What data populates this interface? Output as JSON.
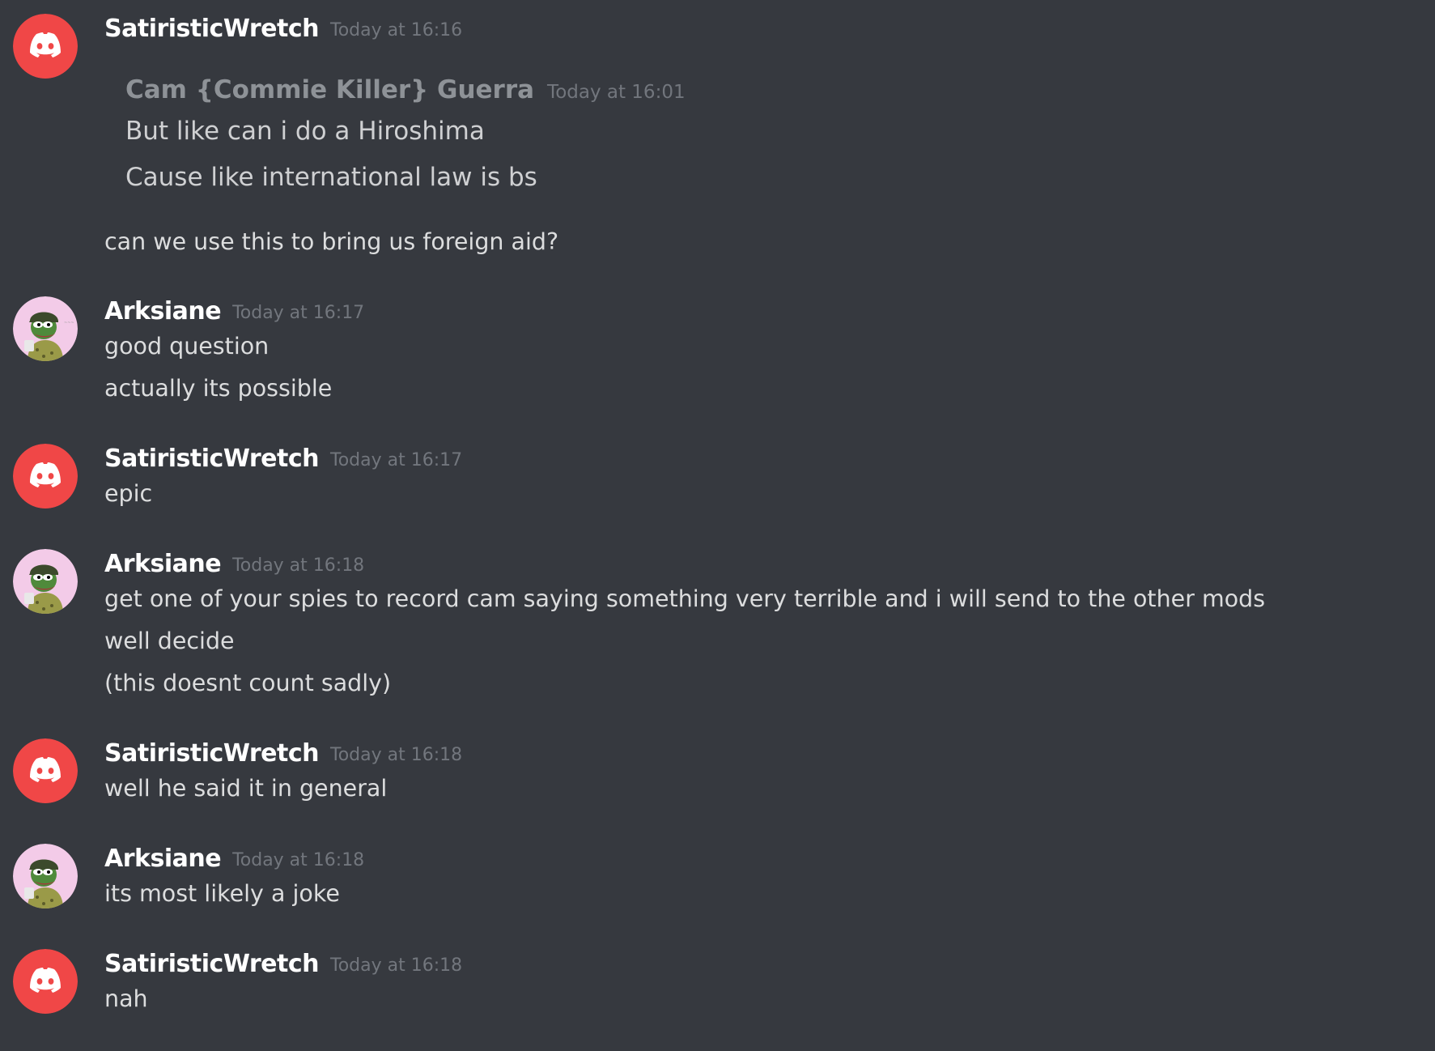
{
  "colors": {
    "background": "#36393f",
    "discord_red": "#f04747",
    "username": "#ffffff",
    "timestamp": "#72767d",
    "message_text": "#dcddde"
  },
  "messages": [
    {
      "author": "SatiristicWretch",
      "avatar_icon": "discord-logo-icon",
      "timestamp": "Today at 16:16",
      "quote": {
        "author": "Cam {Commie Killer} Guerra",
        "timestamp": "Today at 16:01",
        "lines": [
          "But like can i do a Hiroshima",
          "Cause like international law is bs"
        ]
      },
      "lines": [
        "can we use this to bring us foreign aid?"
      ]
    },
    {
      "author": "Arksiane",
      "avatar_icon": "pepe-soldier-avatar-icon",
      "timestamp": "Today at 16:17",
      "lines": [
        "good question",
        "actually its possible"
      ]
    },
    {
      "author": "SatiristicWretch",
      "avatar_icon": "discord-logo-icon",
      "timestamp": "Today at 16:17",
      "lines": [
        "epic"
      ]
    },
    {
      "author": "Arksiane",
      "avatar_icon": "pepe-soldier-avatar-icon",
      "timestamp": "Today at 16:18",
      "lines": [
        "get one of your spies to record cam saying something very terrible and i will send to the other mods",
        "well decide",
        "(this doesnt count sadly)"
      ]
    },
    {
      "author": "SatiristicWretch",
      "avatar_icon": "discord-logo-icon",
      "timestamp": "Today at 16:18",
      "lines": [
        "well he said it in general"
      ]
    },
    {
      "author": "Arksiane",
      "avatar_icon": "pepe-soldier-avatar-icon",
      "timestamp": "Today at 16:18",
      "lines": [
        "its most likely a joke"
      ]
    },
    {
      "author": "SatiristicWretch",
      "avatar_icon": "discord-logo-icon",
      "timestamp": "Today at 16:18",
      "lines": [
        "nah"
      ]
    }
  ]
}
